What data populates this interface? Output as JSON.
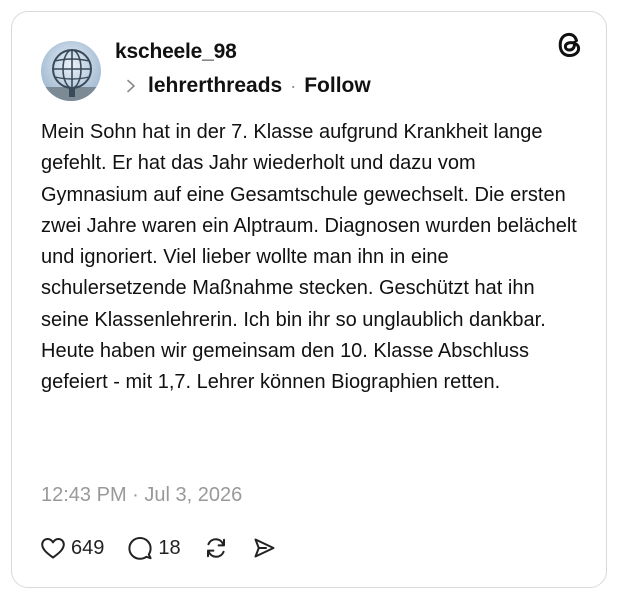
{
  "post": {
    "username": "kscheele_98",
    "topic": "lehrerthreads",
    "follow_label": "Follow",
    "separator": "·",
    "text": "Mein Sohn hat in der 7. Klasse aufgrund Krankheit lange gefehlt. Er hat das Jahr wiederholt und dazu vom Gymnasium auf eine Gesamtschule gewechselt. Die ersten zwei Jahre waren ein Alptraum. Diagnosen wurden belächelt und ignoriert. Viel lieber wollte man ihn in eine schulersetzende Maßnahme stecken. Geschützt hat ihn seine Klassenlehrerin. Ich bin ihr so unglaublich dankbar. Heute haben wir gemeinsam den 10. Klasse Abschluss gefeiert - mit 1,7. Lehrer können Biographien retten.",
    "timestamp": "12:43 PM · Jul 3, 2026"
  },
  "actions": {
    "likes": "649",
    "replies": "18"
  },
  "icons": {
    "logo": "threads-logo-icon",
    "avatar": "globe-avatar",
    "like": "heart-icon",
    "reply": "comment-bubble-icon",
    "repost": "repost-icon",
    "share": "send-icon"
  },
  "colors": {
    "border": "#d9d9d9",
    "muted_text": "#999999",
    "text": "#111111"
  }
}
